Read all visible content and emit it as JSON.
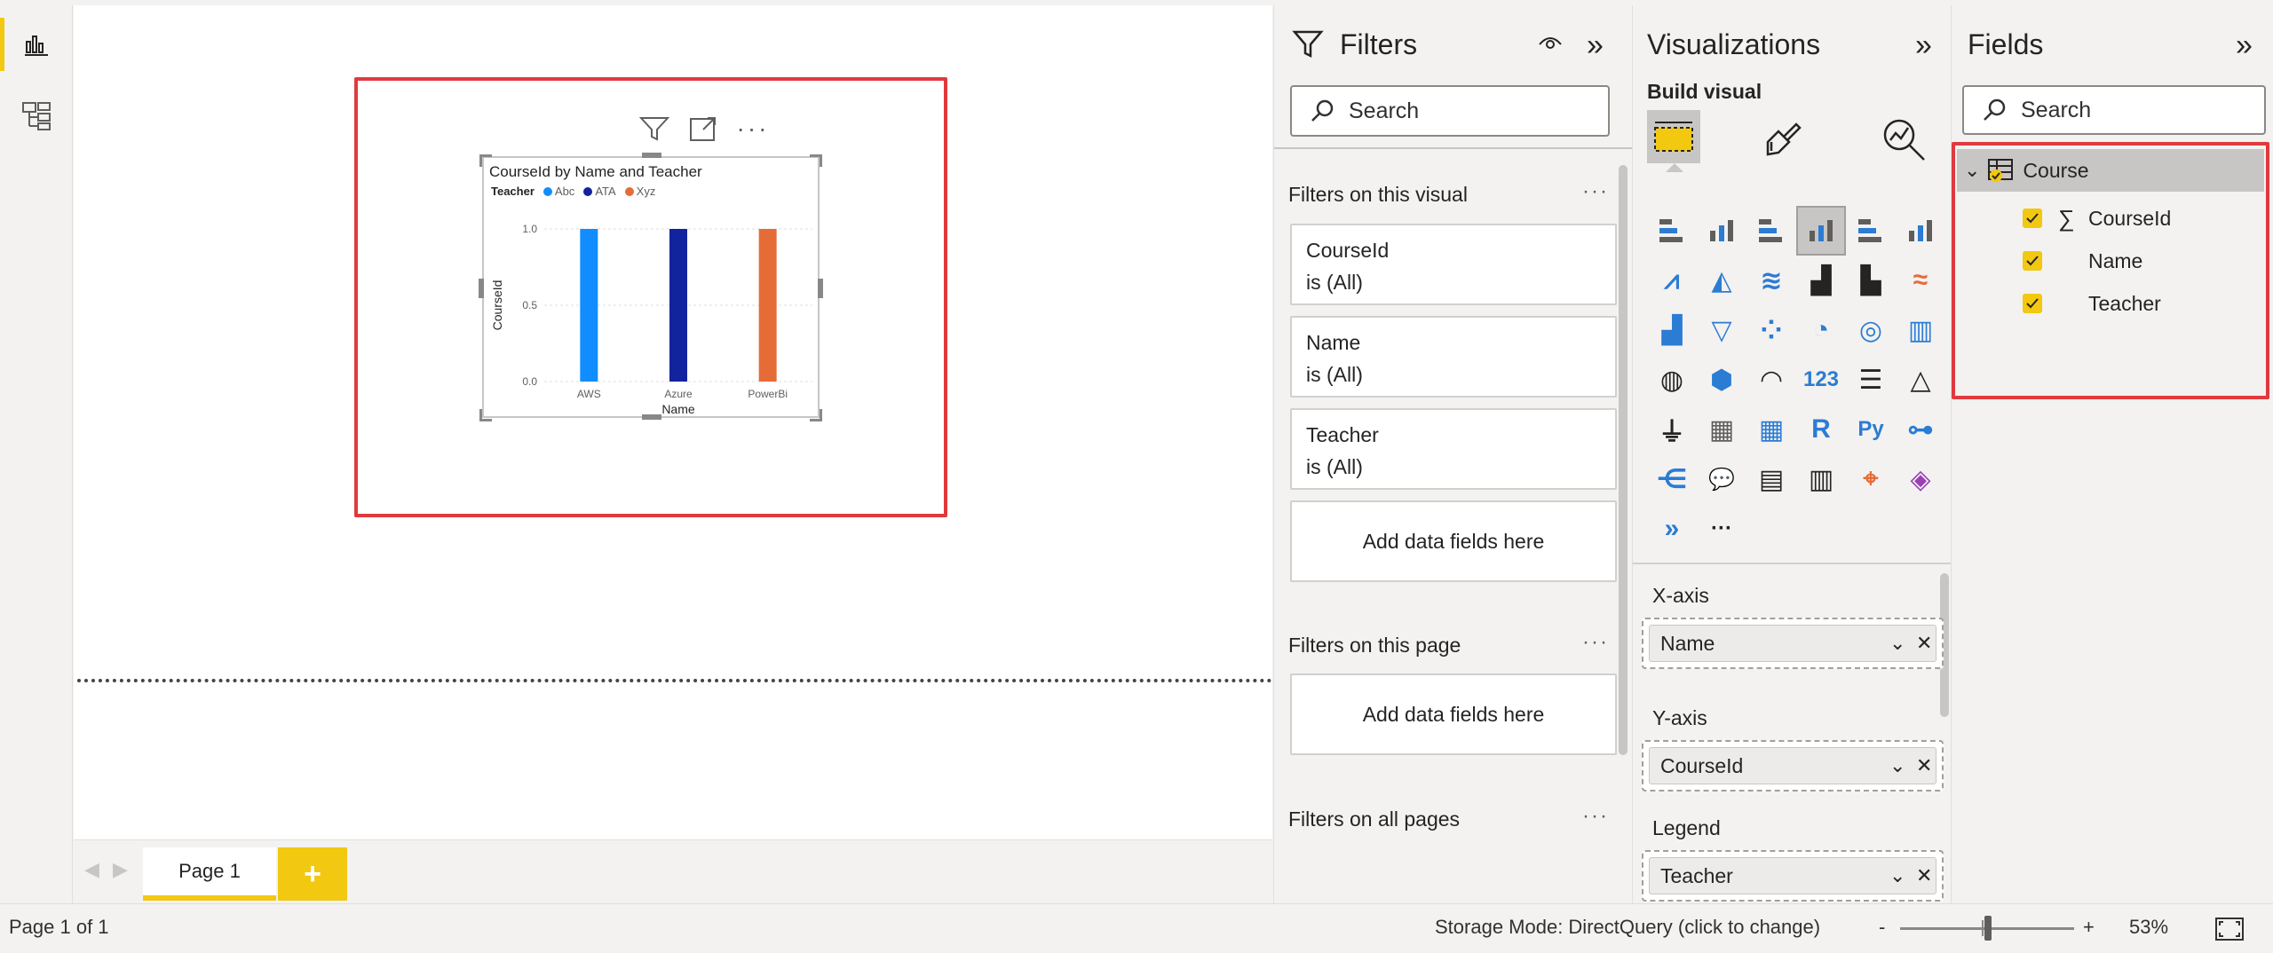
{
  "rail": {
    "items": [
      {
        "icon": "report-view-icon",
        "active": true
      },
      {
        "icon": "model-view-icon",
        "active": false
      }
    ]
  },
  "visual": {
    "title": "CourseId by Name and Teacher",
    "legend_title": "Teacher",
    "legend": [
      {
        "name": "Abc",
        "color": "#118dff"
      },
      {
        "name": "ATA",
        "color": "#12239e"
      },
      {
        "name": "Xyz",
        "color": "#e66c37"
      }
    ]
  },
  "chart_data": {
    "type": "bar",
    "title": "CourseId by Name and Teacher",
    "xlabel": "Name",
    "ylabel": "CourseId",
    "categories": [
      "AWS",
      "Azure",
      "PowerBi"
    ],
    "series": [
      {
        "name": "Abc",
        "values": [
          1,
          0,
          0
        ],
        "color": "#118dff"
      },
      {
        "name": "ATA",
        "values": [
          0,
          1,
          0
        ],
        "color": "#12239e"
      },
      {
        "name": "Xyz",
        "values": [
          0,
          0,
          1
        ],
        "color": "#e66c37"
      }
    ],
    "yticks": [
      "0.0",
      "0.5",
      "1.0"
    ],
    "ylim": [
      0,
      1
    ],
    "legend_title": "Teacher",
    "legend_position": "top-left",
    "grid": true
  },
  "tabs": {
    "pages": [
      {
        "label": "Page 1",
        "active": true
      }
    ],
    "add_label": "+"
  },
  "status": {
    "page_info": "Page 1 of 1",
    "storage_mode": "Storage Mode: DirectQuery (click to change)",
    "zoom_minus": "-",
    "zoom_plus": "+",
    "zoom": "53%",
    "zoom_level": 0.53
  },
  "filters": {
    "title": "Filters",
    "search_placeholder": "Search",
    "on_visual_title": "Filters on this visual",
    "visual_filters": [
      {
        "field": "CourseId",
        "state": "is (All)"
      },
      {
        "field": "Name",
        "state": "is (All)"
      },
      {
        "field": "Teacher",
        "state": "is (All)"
      }
    ],
    "add_data_label": "Add data fields here",
    "on_page_title": "Filters on this page",
    "on_all_pages_title": "Filters on all pages",
    "more": "···"
  },
  "visualizations": {
    "title": "Visualizations",
    "build_visual": "Build visual",
    "wells": [
      {
        "label": "X-axis",
        "field": "Name"
      },
      {
        "label": "Y-axis",
        "field": "CourseId"
      },
      {
        "label": "Legend",
        "field": "Teacher"
      }
    ],
    "more_visuals": "···"
  },
  "fields": {
    "title": "Fields",
    "search_placeholder": "Search",
    "table": "Course",
    "columns": [
      {
        "name": "CourseId",
        "checked": true,
        "sigma": true
      },
      {
        "name": "Name",
        "checked": true,
        "sigma": false
      },
      {
        "name": "Teacher",
        "checked": true,
        "sigma": false
      }
    ]
  },
  "colors": {
    "accent": "#f2c811",
    "highlight": "#e03a3e"
  }
}
